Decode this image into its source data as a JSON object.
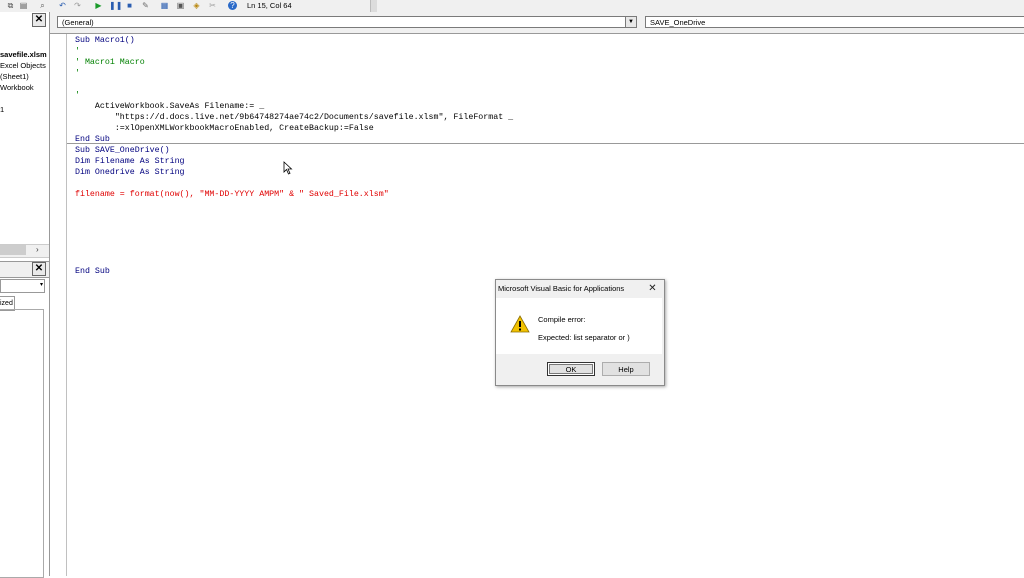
{
  "toolbar": {
    "position": "Ln 15, Col 64",
    "icons": [
      "copy-icon",
      "paste-icon",
      "find-icon",
      "undo-icon",
      "redo-icon",
      "run-icon",
      "break-icon",
      "reset-icon",
      "design-mode-icon",
      "project-explorer-icon",
      "properties-icon",
      "object-browser-icon",
      "toolbox-icon",
      "help-icon"
    ]
  },
  "project_panel": {
    "close_label": "✕",
    "items": [
      "savefile.xlsm",
      "Excel Objects",
      "(Sheet1)",
      "Workbook",
      "1"
    ]
  },
  "properties_panel": {
    "close_label": "✕",
    "tab_label": "ized"
  },
  "code_window": {
    "object_combo": "(General)",
    "procedure_combo": "SAVE_OneDrive",
    "lines": [
      {
        "text": "Sub Macro1()",
        "color": "#00007f"
      },
      {
        "text": "'",
        "color": "#008000"
      },
      {
        "text": "' Macro1 Macro",
        "color": "#008000"
      },
      {
        "text": "'",
        "color": "#008000"
      },
      {
        "text": "",
        "color": "#000000"
      },
      {
        "text": "'",
        "color": "#008000"
      },
      {
        "text": "    ActiveWorkbook.SaveAs Filename:= _",
        "color": "#000000"
      },
      {
        "text": "        \"https://d.docs.live.net/9b64748274ae74c2/Documents/savefile.xlsm\", FileFormat _",
        "color": "#000000"
      },
      {
        "text": "        :=xlOpenXMLWorkbookMacroEnabled, CreateBackup:=False",
        "color": "#000000"
      },
      {
        "text": "End Sub",
        "color": "#00007f"
      },
      {
        "text": "Sub SAVE_OneDrive()",
        "color": "#00007f"
      },
      {
        "text": "Dim Filename As String",
        "color": "#00007f"
      },
      {
        "text": "Dim Onedrive As String",
        "color": "#00007f"
      },
      {
        "text": "",
        "color": "#000000"
      },
      {
        "text": "filename = format(now(), \"MM-DD-YYYY AMPM\" & \" Saved_File.xlsm\"",
        "color": "#e00000"
      },
      {
        "text": "",
        "color": "#000000"
      },
      {
        "text": "",
        "color": "#000000"
      },
      {
        "text": "",
        "color": "#000000"
      },
      {
        "text": "",
        "color": "#000000"
      },
      {
        "text": "",
        "color": "#000000"
      },
      {
        "text": "",
        "color": "#000000"
      },
      {
        "text": "End Sub",
        "color": "#00007f"
      }
    ]
  },
  "dialog": {
    "title": "Microsoft Visual Basic for Applications",
    "close_label": "✕",
    "message_title": "Compile error:",
    "message": "Expected: list separator or )",
    "ok_label": "OK",
    "help_label": "Help"
  }
}
